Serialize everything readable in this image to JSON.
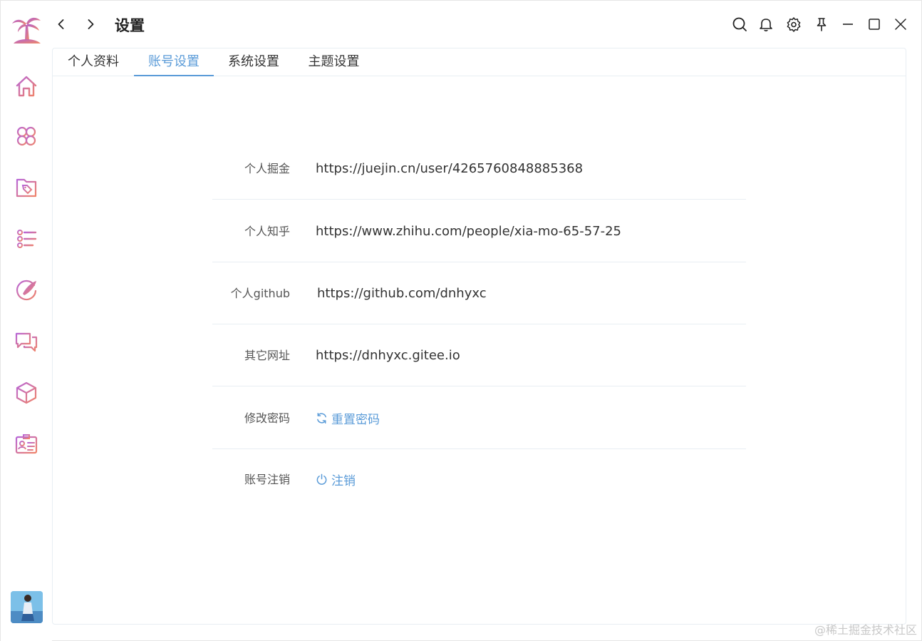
{
  "window": {
    "title": "设置"
  },
  "sidebar": {
    "items": [
      {
        "icon": "home-icon"
      },
      {
        "icon": "apps-icon"
      },
      {
        "icon": "folder-tag-icon"
      },
      {
        "icon": "list-settings-icon"
      },
      {
        "icon": "brush-icon"
      },
      {
        "icon": "chat-icon"
      },
      {
        "icon": "cube-icon"
      },
      {
        "icon": "contact-card-icon"
      }
    ]
  },
  "tabs": [
    {
      "label": "个人资料",
      "active": false
    },
    {
      "label": "账号设置",
      "active": true
    },
    {
      "label": "系统设置",
      "active": false
    },
    {
      "label": "主题设置",
      "active": false
    }
  ],
  "account": {
    "rows": [
      {
        "label": "个人掘金",
        "value": "https://juejin.cn/user/4265760848885368"
      },
      {
        "label": "个人知乎",
        "value": "https://www.zhihu.com/people/xia-mo-65-57-25"
      },
      {
        "label": "个人github",
        "value": "https://github.com/dnhyxc"
      },
      {
        "label": "其它网址",
        "value": "https://dnhyxc.gitee.io"
      },
      {
        "label": "修改密码",
        "action": "重置密码",
        "action_icon": "refresh-icon"
      },
      {
        "label": "账号注销",
        "action": "注销",
        "action_icon": "power-icon"
      }
    ]
  },
  "watermark": "@稀土掘金技术社区",
  "colors": {
    "accent": "#5a9bd8",
    "icon_gradient_start": "#c06ad8",
    "icon_gradient_end": "#f0806a"
  }
}
